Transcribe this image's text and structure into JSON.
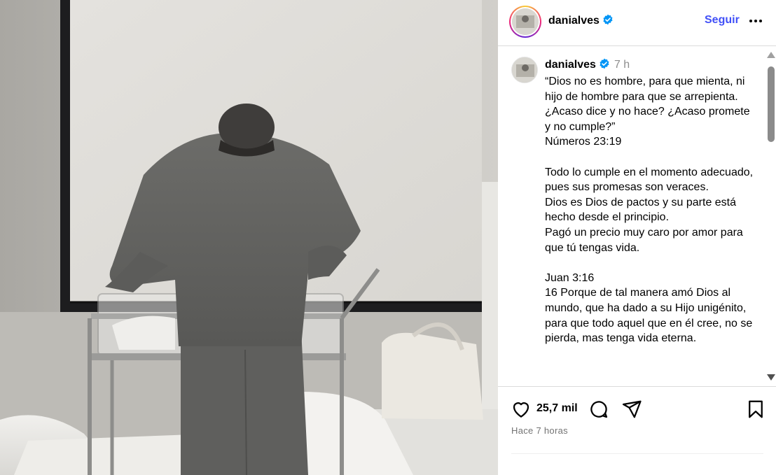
{
  "post": {
    "username": "danialves",
    "follow_label": "Seguir",
    "time_short": "7 h",
    "caption": "“Dios no es hombre, para que mienta, ni hijo de hombre para que se arrepienta. ¿Acaso dice y no hace? ¿Acaso promete y no cumple?”\nNúmeros 23:19\n\nTodo lo cumple en el momento adecuado, pues sus promesas son veraces.\nDios es Dios de pactos y su parte está hecho desde el principio.\nPagó un precio muy caro por amor para que tú tengas vida.\n\nJuan 3:16\n16 Porque de tal manera amó Dios al mundo, que ha dado a su Hijo unigénito, para que todo aquel que en él cree, no se pierda, mas tenga vida eterna.",
    "likes": "25,7 mil",
    "time_ago": "Hace 7 horas"
  },
  "colors": {
    "follow": "#4150f7",
    "verified": "#0095f6",
    "muted": "#737373",
    "divider": "#dbdbdb"
  },
  "icons": {
    "verified": "verified-badge-icon",
    "more": "more-options-icon",
    "like": "heart-icon",
    "comment": "comment-icon",
    "share": "paper-plane-icon",
    "save": "bookmark-icon"
  }
}
